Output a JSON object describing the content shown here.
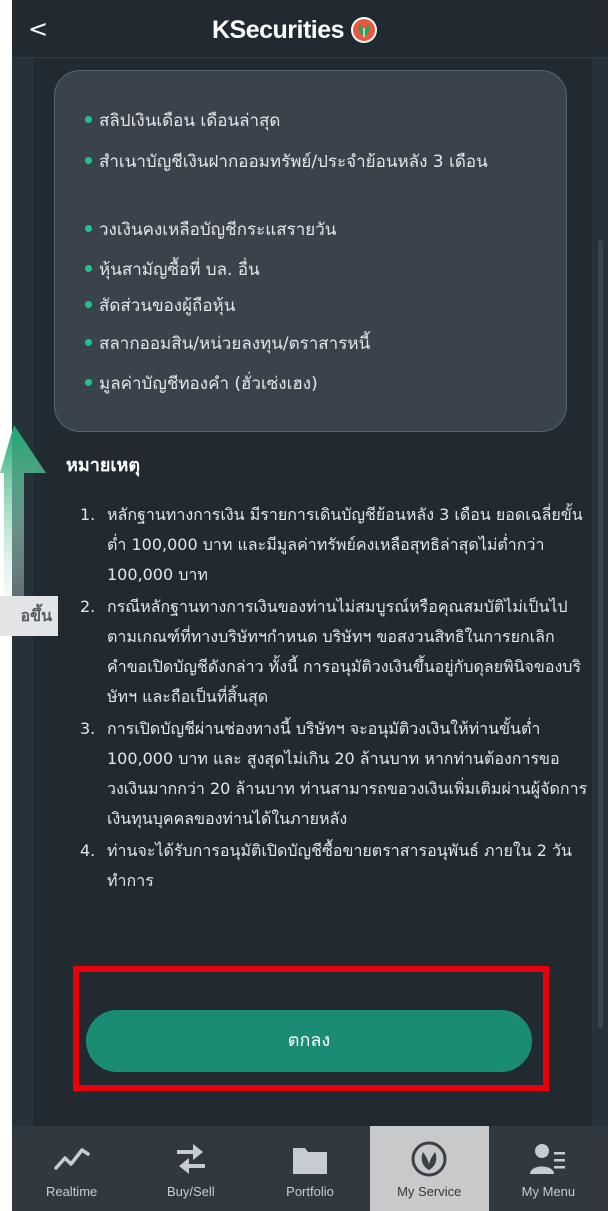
{
  "header": {
    "back_label": "<",
    "brand": "KSecurities"
  },
  "docs": [
    "สลิปเงินเดือน เดือนล่าสุด",
    "สำเนาบัญชีเงินฝากออมทรัพย์/ประจำย้อนหลัง 3 เดือน",
    "วงเงินคงเหลือบัญชีกระแสรายวัน",
    "หุ้นสามัญซื้อที่ บล. อื่น",
    "สัดส่วนของผู้ถือหุ้น",
    "สลากออมสิน/หน่วยลงทุน/ตราสารหนี้",
    "มูลค่าบัญชีทองคำ (ฮั่วเซ่งเฮง)"
  ],
  "notes": {
    "title": "หมายเหตุ",
    "items": [
      {
        "num": "1.",
        "text": "หลักฐานทางการเงิน มีรายการเดินบัญชีย้อนหลัง 3 เดือน ยอดเฉลี่ยขั้นต่ำ 100,000 บาท และมีมูลค่าทรัพย์คงเหลือสุทธิล่าสุดไม่ต่ำกว่า 100,000 บาท"
      },
      {
        "num": "2.",
        "text": "กรณีหลักฐานทางการเงินของท่านไม่สมบูรณ์หรือคุณสมบัติไม่เป็นไปตามเกณฑ์ที่ทางบริษัทฯกำหนด บริษัทฯ ขอสงวนสิทธิในการยกเลิกคำขอเปิดบัญชีดังกล่าว ทั้งนี้ การอนุมัติวงเงินขึ้นอยู่กับดุลยพินิจของบริษัทฯ และถือเป็นที่สิ้นสุด"
      },
      {
        "num": "3.",
        "text": "การเปิดบัญชีผ่านช่องทางนี้ บริษัทฯ จะอนุมัติวงเงินให้ท่านขั้นต่ำ 100,000 บาท และ สูงสุดไม่เกิน 20 ล้านบาท หากท่านต้องการขอวงเงินมากกว่า 20 ล้านบาท ท่านสามารถขอวงเงินเพิ่มเติมผ่านผู้จัดการเงินทุนบุคคลของท่านได้ในภายหลัง"
      },
      {
        "num": "4.",
        "text": "ท่านจะได้รับการอนุมัติเปิดบัญชีซื้อขายตราสารอนุพันธ์ ภายใน 2 วันทำการ"
      }
    ]
  },
  "confirm_label": "ตกลง",
  "overlay_label": "อขึ้น",
  "tabs": [
    {
      "label": "Realtime",
      "icon": "realtime-icon"
    },
    {
      "label": "Buy/Sell",
      "icon": "buy-sell-icon"
    },
    {
      "label": "Portfolio",
      "icon": "portfolio-icon"
    },
    {
      "label": "My Service",
      "icon": "my-service-icon",
      "active": true
    },
    {
      "label": "My Menu",
      "icon": "my-menu-icon"
    }
  ],
  "colors": {
    "accent": "#1ec48e",
    "button": "#1a8c73",
    "highlight": "#e8000a"
  }
}
